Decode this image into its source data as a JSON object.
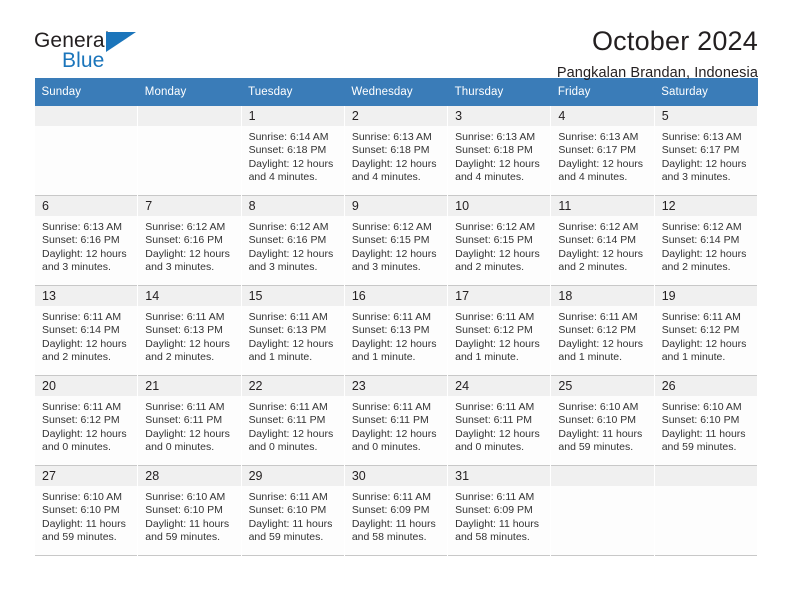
{
  "brand": {
    "name_part1": "General",
    "name_part2": "Blue"
  },
  "header": {
    "title": "October 2024",
    "subtitle": "Pangkalan Brandan, Indonesia"
  },
  "colors": {
    "header_blue": "#3a7cb8",
    "brand_blue": "#1b75bb",
    "daynum_band": "#f0f0f0",
    "grid_line": "#c8c8c8",
    "text": "#231f20"
  },
  "weekday_headers": [
    "Sunday",
    "Monday",
    "Tuesday",
    "Wednesday",
    "Thursday",
    "Friday",
    "Saturday"
  ],
  "weeks": [
    [
      {
        "day": "",
        "lines": []
      },
      {
        "day": "",
        "lines": []
      },
      {
        "day": "1",
        "lines": [
          "Sunrise: 6:14 AM",
          "Sunset: 6:18 PM",
          "Daylight: 12 hours",
          "and 4 minutes."
        ]
      },
      {
        "day": "2",
        "lines": [
          "Sunrise: 6:13 AM",
          "Sunset: 6:18 PM",
          "Daylight: 12 hours",
          "and 4 minutes."
        ]
      },
      {
        "day": "3",
        "lines": [
          "Sunrise: 6:13 AM",
          "Sunset: 6:18 PM",
          "Daylight: 12 hours",
          "and 4 minutes."
        ]
      },
      {
        "day": "4",
        "lines": [
          "Sunrise: 6:13 AM",
          "Sunset: 6:17 PM",
          "Daylight: 12 hours",
          "and 4 minutes."
        ]
      },
      {
        "day": "5",
        "lines": [
          "Sunrise: 6:13 AM",
          "Sunset: 6:17 PM",
          "Daylight: 12 hours",
          "and 3 minutes."
        ]
      }
    ],
    [
      {
        "day": "6",
        "lines": [
          "Sunrise: 6:13 AM",
          "Sunset: 6:16 PM",
          "Daylight: 12 hours",
          "and 3 minutes."
        ]
      },
      {
        "day": "7",
        "lines": [
          "Sunrise: 6:12 AM",
          "Sunset: 6:16 PM",
          "Daylight: 12 hours",
          "and 3 minutes."
        ]
      },
      {
        "day": "8",
        "lines": [
          "Sunrise: 6:12 AM",
          "Sunset: 6:16 PM",
          "Daylight: 12 hours",
          "and 3 minutes."
        ]
      },
      {
        "day": "9",
        "lines": [
          "Sunrise: 6:12 AM",
          "Sunset: 6:15 PM",
          "Daylight: 12 hours",
          "and 3 minutes."
        ]
      },
      {
        "day": "10",
        "lines": [
          "Sunrise: 6:12 AM",
          "Sunset: 6:15 PM",
          "Daylight: 12 hours",
          "and 2 minutes."
        ]
      },
      {
        "day": "11",
        "lines": [
          "Sunrise: 6:12 AM",
          "Sunset: 6:14 PM",
          "Daylight: 12 hours",
          "and 2 minutes."
        ]
      },
      {
        "day": "12",
        "lines": [
          "Sunrise: 6:12 AM",
          "Sunset: 6:14 PM",
          "Daylight: 12 hours",
          "and 2 minutes."
        ]
      }
    ],
    [
      {
        "day": "13",
        "lines": [
          "Sunrise: 6:11 AM",
          "Sunset: 6:14 PM",
          "Daylight: 12 hours",
          "and 2 minutes."
        ]
      },
      {
        "day": "14",
        "lines": [
          "Sunrise: 6:11 AM",
          "Sunset: 6:13 PM",
          "Daylight: 12 hours",
          "and 2 minutes."
        ]
      },
      {
        "day": "15",
        "lines": [
          "Sunrise: 6:11 AM",
          "Sunset: 6:13 PM",
          "Daylight: 12 hours",
          "and 1 minute."
        ]
      },
      {
        "day": "16",
        "lines": [
          "Sunrise: 6:11 AM",
          "Sunset: 6:13 PM",
          "Daylight: 12 hours",
          "and 1 minute."
        ]
      },
      {
        "day": "17",
        "lines": [
          "Sunrise: 6:11 AM",
          "Sunset: 6:12 PM",
          "Daylight: 12 hours",
          "and 1 minute."
        ]
      },
      {
        "day": "18",
        "lines": [
          "Sunrise: 6:11 AM",
          "Sunset: 6:12 PM",
          "Daylight: 12 hours",
          "and 1 minute."
        ]
      },
      {
        "day": "19",
        "lines": [
          "Sunrise: 6:11 AM",
          "Sunset: 6:12 PM",
          "Daylight: 12 hours",
          "and 1 minute."
        ]
      }
    ],
    [
      {
        "day": "20",
        "lines": [
          "Sunrise: 6:11 AM",
          "Sunset: 6:12 PM",
          "Daylight: 12 hours",
          "and 0 minutes."
        ]
      },
      {
        "day": "21",
        "lines": [
          "Sunrise: 6:11 AM",
          "Sunset: 6:11 PM",
          "Daylight: 12 hours",
          "and 0 minutes."
        ]
      },
      {
        "day": "22",
        "lines": [
          "Sunrise: 6:11 AM",
          "Sunset: 6:11 PM",
          "Daylight: 12 hours",
          "and 0 minutes."
        ]
      },
      {
        "day": "23",
        "lines": [
          "Sunrise: 6:11 AM",
          "Sunset: 6:11 PM",
          "Daylight: 12 hours",
          "and 0 minutes."
        ]
      },
      {
        "day": "24",
        "lines": [
          "Sunrise: 6:11 AM",
          "Sunset: 6:11 PM",
          "Daylight: 12 hours",
          "and 0 minutes."
        ]
      },
      {
        "day": "25",
        "lines": [
          "Sunrise: 6:10 AM",
          "Sunset: 6:10 PM",
          "Daylight: 11 hours",
          "and 59 minutes."
        ]
      },
      {
        "day": "26",
        "lines": [
          "Sunrise: 6:10 AM",
          "Sunset: 6:10 PM",
          "Daylight: 11 hours",
          "and 59 minutes."
        ]
      }
    ],
    [
      {
        "day": "27",
        "lines": [
          "Sunrise: 6:10 AM",
          "Sunset: 6:10 PM",
          "Daylight: 11 hours",
          "and 59 minutes."
        ]
      },
      {
        "day": "28",
        "lines": [
          "Sunrise: 6:10 AM",
          "Sunset: 6:10 PM",
          "Daylight: 11 hours",
          "and 59 minutes."
        ]
      },
      {
        "day": "29",
        "lines": [
          "Sunrise: 6:11 AM",
          "Sunset: 6:10 PM",
          "Daylight: 11 hours",
          "and 59 minutes."
        ]
      },
      {
        "day": "30",
        "lines": [
          "Sunrise: 6:11 AM",
          "Sunset: 6:09 PM",
          "Daylight: 11 hours",
          "and 58 minutes."
        ]
      },
      {
        "day": "31",
        "lines": [
          "Sunrise: 6:11 AM",
          "Sunset: 6:09 PM",
          "Daylight: 11 hours",
          "and 58 minutes."
        ]
      },
      {
        "day": "",
        "lines": []
      },
      {
        "day": "",
        "lines": []
      }
    ]
  ]
}
